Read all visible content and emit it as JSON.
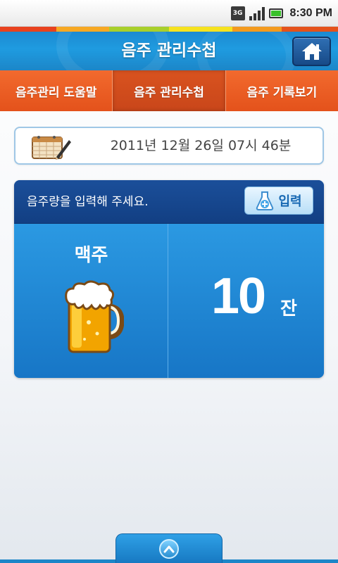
{
  "status_bar": {
    "network_label": "3G",
    "time": "8:30 PM",
    "icons": [
      "3g-icon",
      "signal-icon",
      "battery-icon"
    ]
  },
  "header": {
    "title": "음주 관리수첩",
    "home_icon": "home-icon"
  },
  "tabs": [
    {
      "label": "음주관리 도움말",
      "active": false
    },
    {
      "label": "음주 관리수첩",
      "active": true
    },
    {
      "label": "음주 기록보기",
      "active": false
    }
  ],
  "date": {
    "icon": "calendar-pen-icon",
    "text": "2011년 12월 26일 07시 46분"
  },
  "entry": {
    "prompt": "음주량을 입력해 주세요.",
    "input_button_label": "입력",
    "input_button_icon": "flask-plus-icon",
    "drink_name": "맥주",
    "drink_icon": "beer-mug-icon",
    "count": "10",
    "unit": "잔"
  },
  "footer": {
    "handle_icon": "chevron-up-icon"
  },
  "colors": {
    "title_blue": "#1f9be0",
    "tab_orange": "#f26a2e",
    "tab_active": "#c9461a",
    "panel_dark": "#123f83",
    "panel_blue": "#1f82d0",
    "stripe": [
      "#e8421e",
      "#f7a823",
      "#a8cf2b",
      "#f6e21f",
      "#f39a1e",
      "#e4521b"
    ]
  }
}
